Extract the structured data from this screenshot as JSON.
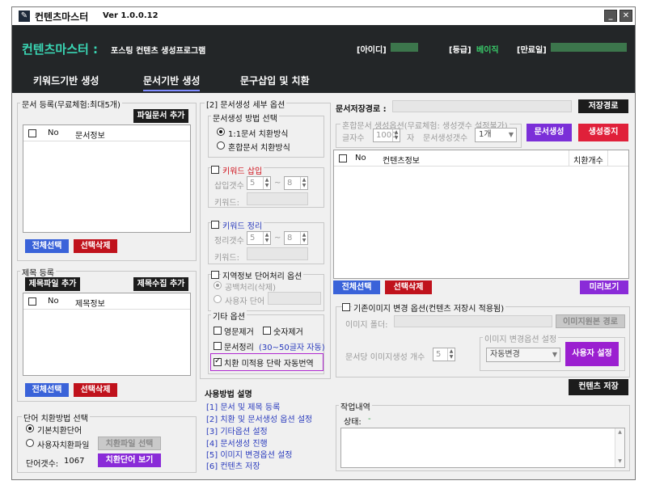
{
  "window": {
    "title": "컨텐츠마스터",
    "version": "Ver 1.0.0.12",
    "minimize": "_",
    "close": "✕"
  },
  "header": {
    "app_title": "컨텐츠마스터 :",
    "app_subtitle": "포스팅 컨텐츠 생성프로그램",
    "id_label": "[아이디]",
    "grade_label": "[등급]",
    "grade_value": "베이직",
    "expiry_label": "[만료일]"
  },
  "tabs": [
    {
      "label": "키워드기반 생성"
    },
    {
      "label": "문서기반 생성"
    },
    {
      "label": "문구삽입 및 치환"
    }
  ],
  "doc_register": {
    "group_label": "문서 등록(무료체험:최대5개)",
    "add_button": "파일문서 추가",
    "col_no": "No",
    "col_info": "문서정보",
    "select_all": "전체선택",
    "delete_selected": "선택삭제"
  },
  "title_register": {
    "group_label": "제목 등록",
    "file_add_button": "제목파일 추가",
    "collect_button": "제목수집 추가",
    "col_no": "No",
    "col_info": "제목정보",
    "select_all": "전체선택",
    "delete_selected": "선택삭제"
  },
  "word_replace": {
    "group_label": "단어 치환방법 선택",
    "opt_basic": "기본치환단어",
    "opt_user": "사용자치환파일",
    "select_file_button": "치환파일 선택",
    "word_count_label": "단어갯수:",
    "word_count": "1067",
    "view_button": "치환단어 보기"
  },
  "options": {
    "group_label": "[2] 문서생성 세부 옵션",
    "method_label": "문서생성 방법 선택",
    "method_1to1": "1:1문서 치환방식",
    "method_mixed": "혼합문서 치환방식",
    "keyword_insert_label": "키워드 삽입",
    "insert_count_label": "삽입갯수",
    "insert_min": "5",
    "insert_max": "8",
    "tilde": "~",
    "keyword_label": "키워드:",
    "keyword_clean_label": "키워드 정리",
    "clean_count_label": "정리갯수",
    "clean_min": "5",
    "clean_max": "8",
    "keyword_label2": "키워드:",
    "region_label": "지역정보 단어처리 옵션",
    "region_space": "공백처리(삭제)",
    "region_user": "사용자 단어",
    "etc_label": "기타 옵션",
    "remove_english": "영문제거",
    "remove_number": "숫자제거",
    "doc_tidy": "문서정리",
    "doc_tidy_note": "(30~50글자 자동)",
    "auto_translate": "치환 미적용 단락 자동번역"
  },
  "usage": {
    "title": "사용방법 설명",
    "steps": [
      "[1] 문서 및 제목 등록",
      "[2] 치환 및 문서생성 옵션 설정",
      "[3] 기타옵션 설정",
      "[4] 문서생성 진행",
      "[5] 이미지 변경옵션 설정",
      "[6] 컨텐츠 저장"
    ]
  },
  "save_path": {
    "label": "문서저장경로 :",
    "button": "저장경로"
  },
  "mix_options": {
    "group_label": "혼합문서 생성옵션(무료체험: 생성갯수 설정불가)",
    "char_count_label": "글자수",
    "char_count": "1000",
    "char_unit": "자",
    "gen_count_label": "문서생성갯수",
    "gen_count": "1개",
    "generate_button": "문서생성",
    "stop_button": "생성중지"
  },
  "content_list": {
    "col_no": "No",
    "col_info": "컨텐츠정보",
    "col_replace": "치환개수",
    "select_all": "전체선택",
    "delete_selected": "선택삭제",
    "preview": "미리보기"
  },
  "image_options": {
    "group_label": "기존이미지 변경 옵션(컨텐츠 저장시 적용됨)",
    "folder_label": "이미지 폴더:",
    "path_button": "이미지원본 경로",
    "sub_group_label": "이미지 변경옵션 설정",
    "per_doc_label": "문서당 이미지생성 개수",
    "per_doc_value": "5",
    "mode_value": "자동변경",
    "user_setting_button": "사용자 설정"
  },
  "save_content_button": "컨텐츠 저장",
  "work_log": {
    "group_label": "작업내역",
    "status_label": "상태:",
    "status_value": "-"
  }
}
